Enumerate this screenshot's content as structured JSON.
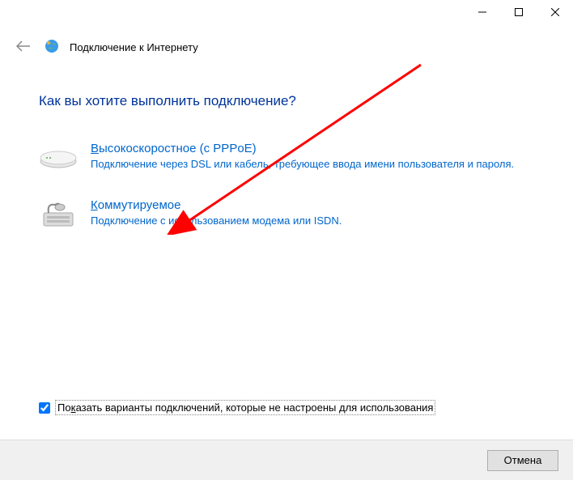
{
  "header": {
    "window_title": "Подключение к Интернету"
  },
  "content": {
    "heading": "Как вы хотите выполнить подключение?",
    "options": [
      {
        "title_prefix": "В",
        "title_rest": "ысокоскоростное (с PPPoE)",
        "description": "Подключение через DSL или кабель, требующее ввода имени пользователя и пароля."
      },
      {
        "title_prefix": "К",
        "title_rest": "оммутируемое",
        "description": "Подключение с использованием модема или ISDN."
      }
    ]
  },
  "checkbox": {
    "label_prefix": "По",
    "label_accel": "к",
    "label_rest": "азать варианты подключений, которые не настроены для использования"
  },
  "buttons": {
    "cancel": "Отмена"
  }
}
